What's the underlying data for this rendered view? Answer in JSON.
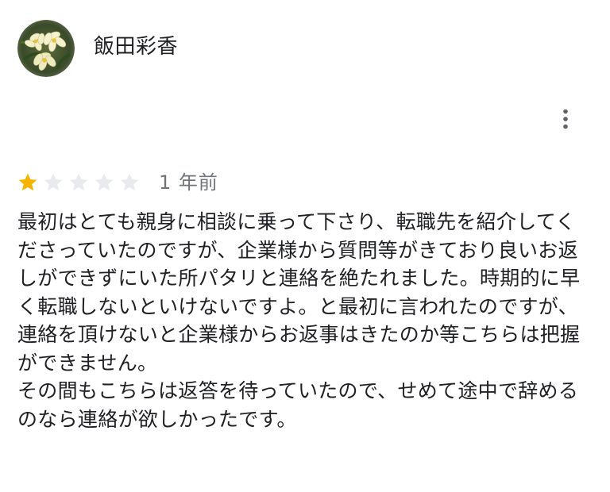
{
  "reviewer": {
    "name": "飯田彩香",
    "avatar_icon": "flower-photo-avatar"
  },
  "actions": {
    "more_icon": "more-vert-icon"
  },
  "rating": {
    "value": 1,
    "max": 5,
    "filled_color": "#f4b400",
    "empty_color": "#e8eaed",
    "time_ago": "1 年前"
  },
  "review": {
    "text": "最初はとても親身に相談に乗って下さり、転職先を紹介してくださっていたのですが、企業様から質問等がきており良いお返しができずにいた所パタリと連絡を絶たれました。時期的に早く転職しないといけないですよ。と最初に言われたのですが、連絡を頂けないと企業様からお返事はきたのか等こちらは把握ができません。\nその間もこちらは返答を待っていたので、せめて途中で辞めるのなら連絡が欲しかったです。"
  }
}
